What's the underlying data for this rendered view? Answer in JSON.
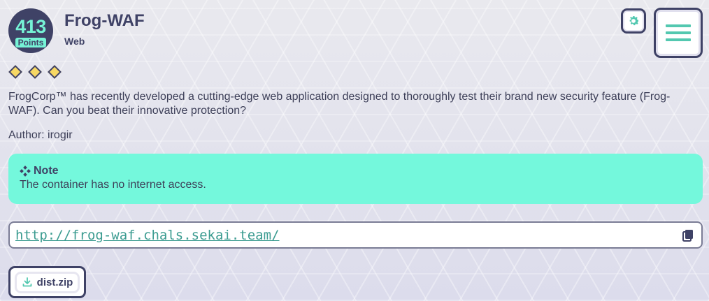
{
  "challenge": {
    "points": "413",
    "points_label": "Points",
    "title": "Frog-WAF",
    "category": "Web",
    "difficulty_level": 3,
    "description": "FrogCorp™ has recently developed a cutting-edge web application designed to thoroughly test their brand new security feature (Frog-WAF). Can you beat their innovative protection?",
    "author": "Author: irogir"
  },
  "note": {
    "title": "Note",
    "body": "The container has no internet access.",
    "icon": "diamond-cluster-icon"
  },
  "connection": {
    "url": "http://frog-waf.chals.sekai.team/",
    "copy_icon": "copy-icon"
  },
  "files": [
    {
      "label": "dist.zip",
      "icon": "download-icon"
    }
  ],
  "toolbar": {
    "settings_icon": "gear-icon",
    "menu_icon": "hamburger-menu-icon"
  },
  "colors": {
    "navy": "#3f4266",
    "mint": "#74f8dc",
    "teal": "#53c8b0",
    "diamond_yellow": "#f7d863"
  }
}
